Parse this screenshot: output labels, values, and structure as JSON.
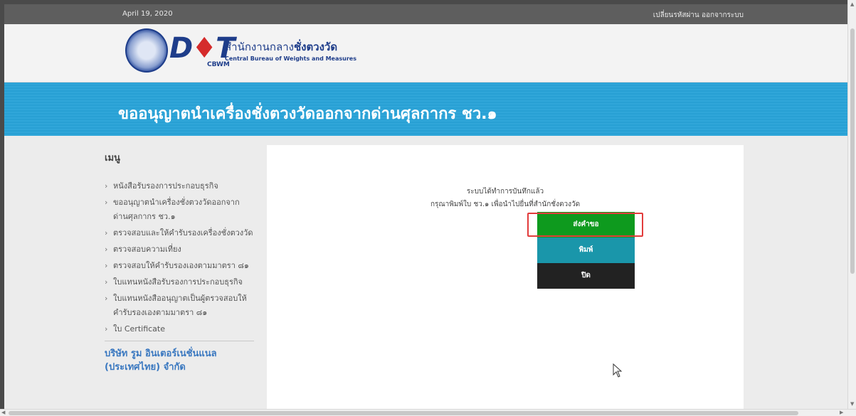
{
  "topbar": {
    "date": "April 19, 2020",
    "change_password": "เปลี่ยนรหัสผ่าน",
    "logout": "ออกจากระบบ"
  },
  "header": {
    "logo_text_1": "D",
    "logo_text_2": "T",
    "logo_sub": "CBWM",
    "org_thai_plain": "สำนักงานกลาง",
    "org_thai_bold": "ชั่งตวงวัด",
    "org_en": "Central Bureau of Weights and Measures"
  },
  "banner": {
    "title": "ขออนุญาตนำเครื่องชั่งตวงวัดออกจากด่านศุลกากร ชว.๑"
  },
  "sidebar": {
    "title": "เมนู",
    "items": [
      {
        "label": "หนังสือรับรองการประกอบธุรกิจ"
      },
      {
        "label": "ขออนุญาตนำเครื่องชั่งตวงวัดออกจากด่านศุลกากร ชว.๑"
      },
      {
        "label": "ตรวจสอบและให้คำรับรองเครื่องชั่งตวงวัด"
      },
      {
        "label": "ตรวจสอบความเที่ยง"
      },
      {
        "label": "ตรวจสอบให้คำรับรองเองตามมาตรา ๘๑"
      },
      {
        "label": "ใบแทนหนังสือรับรองการประกอบธุรกิจ"
      },
      {
        "label": "ใบแทนหนังสืออนุญาตเป็นผู้ตรวจสอบให้คำรับรองเองตามมาตรา ๘๑"
      },
      {
        "label": "ใบ Certificate"
      }
    ],
    "company": "บริษัท รูม อินเตอร์เนชั่นแนล (ประเทศไทย) จำกัด"
  },
  "main": {
    "message_1": "ระบบได้ทำการบันทึกแล้ว",
    "message_2": "กรุณาพิมพ์ใบ ชว.๑ เพื่อนำไปยื่นที่สำนักชั่งตวงวัด",
    "submit_label": "ส่งคำขอ",
    "print_label": "พิมพ์",
    "close_label": "ปิด"
  },
  "icons": {
    "chevron": "›",
    "cursor": "pointer-arrow-icon"
  },
  "colors": {
    "banner": "#29a3d8",
    "submit": "#0e9a1e",
    "print": "#1a96aa",
    "close": "#222222",
    "highlight": "#e23c3c"
  }
}
